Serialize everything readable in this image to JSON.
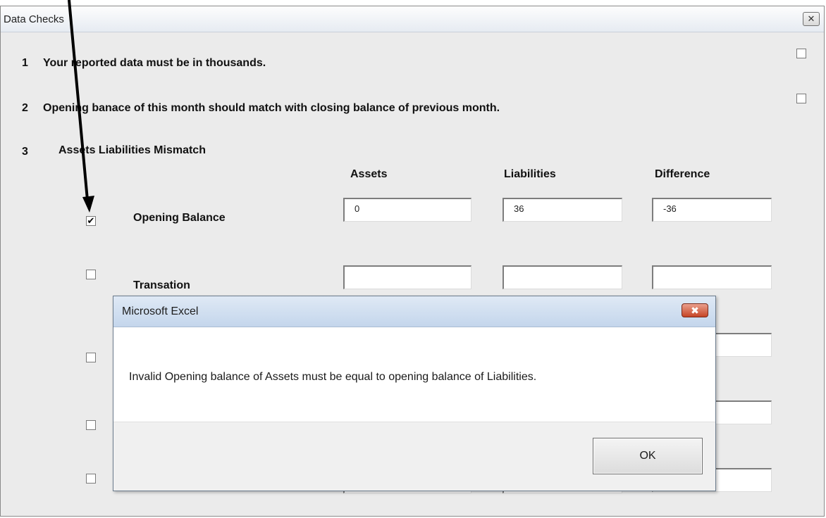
{
  "window": {
    "title": "Data Checks",
    "close_glyph": "✕"
  },
  "checks": [
    {
      "number": "1",
      "label": "Your reported data must be in thousands.",
      "checked": false
    },
    {
      "number": "2",
      "label": "Opening banace of this month should match with closing balance of previous month.",
      "checked": false
    },
    {
      "number": "3",
      "label": "Assets Liabilities Mismatch"
    }
  ],
  "columns": [
    "Assets",
    "Liabilities",
    "Difference"
  ],
  "rows": [
    {
      "label": "Opening Balance",
      "checked": true,
      "checkmark": "✔",
      "assets": "0",
      "liabilities": "36",
      "difference": "-36"
    },
    {
      "label": "Transation",
      "checked": false,
      "assets": "",
      "liabilities": "",
      "difference": ""
    },
    {
      "label": "",
      "checked": false,
      "assets": "",
      "liabilities": "",
      "difference": ""
    },
    {
      "label": "",
      "checked": false,
      "assets": "",
      "liabilities": "",
      "difference": ""
    },
    {
      "label": "",
      "checked": false,
      "assets": "",
      "liabilities": "",
      "difference": ""
    }
  ],
  "dialog": {
    "title": "Microsoft Excel",
    "close_glyph": "✖",
    "message": "Invalid Opening balance of Assets must be equal to opening balance of Liabilities.",
    "ok_label": "OK"
  },
  "colors": {
    "dialog_close_red": "#c64526",
    "annotation_arrow": "#000000"
  },
  "icons": [
    "close-icon",
    "checkmark-icon",
    "arrow-annotation"
  ]
}
